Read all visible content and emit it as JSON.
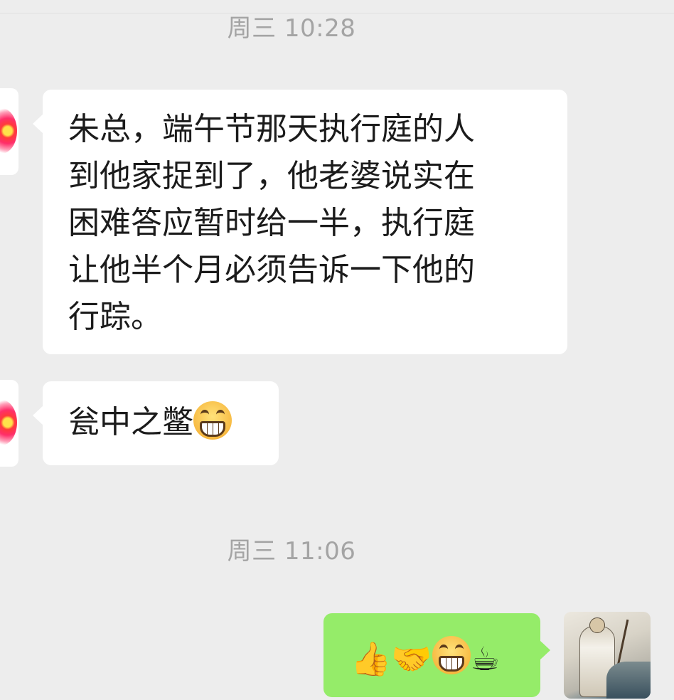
{
  "timestamps": [
    "周三 10:28",
    "周三 11:06"
  ],
  "messages": [
    {
      "side": "left",
      "lines": [
        "朱总，端午节那天执行庭的人",
        "到他家捉到了，他老婆说实在",
        "困难答应暂时给一半，执行庭",
        "让他半个月必须告诉一下他的",
        "行踪。"
      ]
    },
    {
      "side": "left",
      "text": "瓮中之鳖",
      "emoji": "grin-icon"
    },
    {
      "side": "right",
      "emojis": [
        "👍",
        "🤝",
        "grin-icon",
        "☕"
      ]
    }
  ],
  "colors": {
    "background": "#ededed",
    "incoming_bubble": "#ffffff",
    "outgoing_bubble": "#95ec69",
    "timestamp": "#a4a4a4"
  },
  "icons": {
    "left_avatar": "flower-avatar",
    "right_avatar": "ink-painting-scholar-avatar"
  }
}
